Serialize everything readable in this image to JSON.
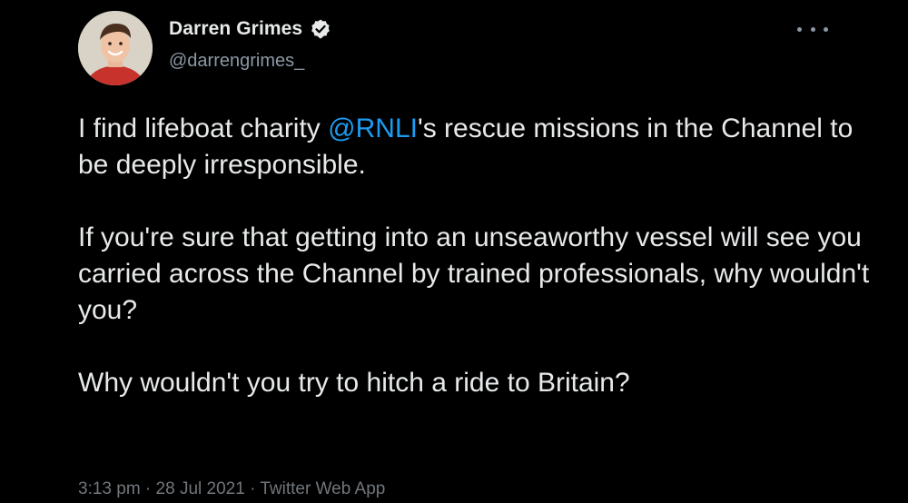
{
  "tweet": {
    "author": {
      "display_name": "Darren Grimes",
      "handle": "@darrengrimes_",
      "verified": true
    },
    "text": {
      "p1_before": "I find lifeboat charity ",
      "p1_mention": "@RNLI",
      "p1_after": "'s rescue missions in the Channel to be deeply irresponsible.",
      "p2": "If you're sure that getting into an unseaworthy vessel will see you carried across the Channel by trained professionals, why wouldn't you?",
      "p3": "Why wouldn't you try to hitch a ride to Britain?"
    },
    "meta": {
      "time": "3:13 pm",
      "separator": " · ",
      "date": "28 Jul 2021",
      "source": "Twitter Web App"
    }
  },
  "icons": {
    "verified": "verified-badge-icon",
    "more": "more-options-icon"
  },
  "colors": {
    "background": "#000000",
    "text": "#e7e9ea",
    "secondary": "#8b98a5",
    "mention": "#1d9bf0"
  }
}
